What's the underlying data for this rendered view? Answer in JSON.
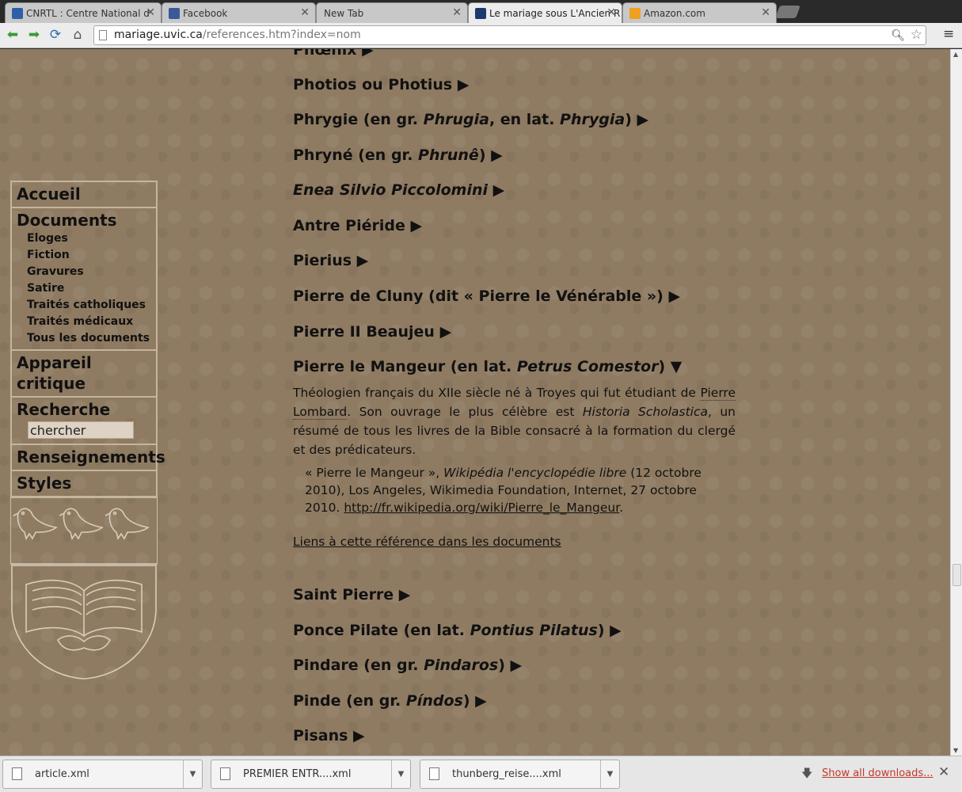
{
  "tabs": [
    {
      "title": "CNRTL : Centre National d",
      "favicon_color": "#2d5fa6"
    },
    {
      "title": "Facebook",
      "favicon_color": "#3b5998"
    },
    {
      "title": "New Tab",
      "favicon_color": ""
    },
    {
      "title": "Le mariage sous L'Ancien R",
      "favicon_color": "#1c3a6e"
    },
    {
      "title": "Amazon.com",
      "favicon_color": "#f0a020"
    }
  ],
  "address": {
    "domain": "mariage.uvic.ca",
    "path": "/references.htm?index=nom"
  },
  "sidebar": {
    "accueil": "Accueil",
    "documents": "Documents",
    "doc_items": [
      "Eloges",
      "Fiction",
      "Gravures",
      "Satire",
      "Traités catholiques",
      "Traités médicaux",
      "Tous les documents"
    ],
    "appareil": "Appareil critique",
    "recherche": "Recherche",
    "search_value": "chercher",
    "renseignements": "Renseignements",
    "styles": "Styles"
  },
  "refs": {
    "phoenix": "Phœnix ▶",
    "photios": "Photios ou Photius ▶",
    "phrygie_a": "Phrygie (en gr. ",
    "phrygie_b": "Phrugia",
    "phrygie_c": ", en lat. ",
    "phrygie_d": "Phrygia",
    "phrygie_e": ") ▶",
    "phryne_a": "Phryné (en gr. ",
    "phryne_b": "Phrunê",
    "phryne_c": ") ▶",
    "enea_a": "Enea Silvio Piccolomini",
    "enea_b": " ▶",
    "antre": "Antre Piéride ▶",
    "pierius": "Pierius ▶",
    "cluny": "Pierre de Cluny (dit « Pierre le Vénérable ») ▶",
    "beaujeu": "Pierre II Beaujeu ▶",
    "mangeur_a": "Pierre le Mangeur (en lat. ",
    "mangeur_b": "Petrus Comestor",
    "mangeur_c": ") ▼",
    "saint": "Saint Pierre ▶",
    "ponce_a": "Ponce Pilate (en lat. ",
    "ponce_b": "Pontius Pilatus",
    "ponce_c": ") ▶",
    "pindare_a": "Pindare (en gr. ",
    "pindare_b": "Pindaros",
    "pindare_c": ") ▶",
    "pinde_a": "Pinde (en gr. ",
    "pinde_b": "Píndos",
    "pinde_c": ") ▶",
    "pisans": "Pisans ▶"
  },
  "description": {
    "t1": "Théologien français du XIIe siècle né à Troyes qui fut étudiant de ",
    "link": "Pierre Lombard",
    "t2": ". Son ouvrage le plus célèbre est ",
    "italic": "Historia Scholastica",
    "t3": ", un résumé de tous les livres de la Bible consacré à la formation du clergé et des prédicateurs."
  },
  "citation": {
    "t1": "« Pierre le Mangeur », ",
    "italic": "Wikipédia l'encyclopédie libre",
    "t2": " (12 octobre 2010), Los Angeles, Wikimedia Foundation, Internet, 27 octobre 2010. ",
    "url": "http://fr.wikipedia.org/wiki/Pierre_le_Mangeur",
    "t3": "."
  },
  "liens": "Liens à cette référence dans les documents",
  "downloads": {
    "items": [
      "article.xml",
      "PREMIER ENTR....xml",
      "thunberg_reise....xml"
    ],
    "show_all": "Show all downloads..."
  }
}
